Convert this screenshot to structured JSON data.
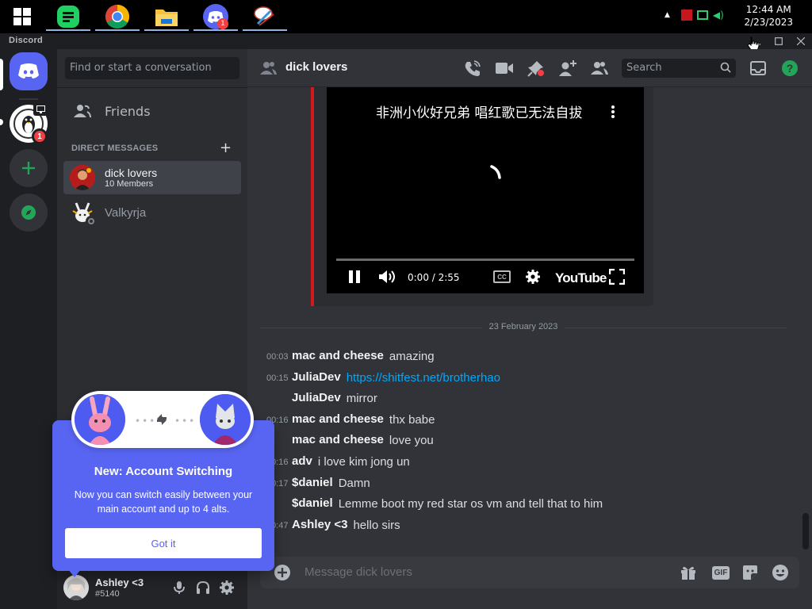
{
  "taskbar": {
    "apps": [
      {
        "name": "start",
        "icon": "windows-logo-icon"
      },
      {
        "name": "notes",
        "icon": "green-notes-icon"
      },
      {
        "name": "chrome",
        "icon": "chrome-icon"
      },
      {
        "name": "explorer",
        "icon": "folder-icon"
      },
      {
        "name": "discord",
        "icon": "discord-icon",
        "badge": "1"
      },
      {
        "name": "paint",
        "icon": "paint-brush-icon"
      }
    ],
    "clock_time": "12:44 AM",
    "clock_date": "2/23/2023"
  },
  "window": {
    "app_label": "Discord"
  },
  "servers": {
    "badge_count": "1"
  },
  "sidebar": {
    "search_placeholder": "Find or start a conversation",
    "friends_label": "Friends",
    "dm_heading": "DIRECT MESSAGES",
    "dms": [
      {
        "name": "dick lovers",
        "sub": "10 Members",
        "active": true
      },
      {
        "name": "Valkyrja",
        "sub": "",
        "active": false
      }
    ]
  },
  "user": {
    "name": "Ashley <3",
    "tag": "#5140"
  },
  "header": {
    "channel_name": "dick lovers",
    "search_placeholder": "Search"
  },
  "embed": {
    "video_title": "非洲小伙好兄弟 唱红歌已无法自拔",
    "time": "0:00 / 2:55",
    "provider": "YouTube",
    "cc_label": "CC"
  },
  "chat": {
    "date_divider": "23 February 2023",
    "messages": [
      {
        "time": "00:03",
        "author": "mac and cheese",
        "content": "amazing",
        "link": false
      },
      {
        "time": "00:15",
        "author": "JuliaDev",
        "content": "https://shitfest.net/brotherhao",
        "link": true
      },
      {
        "time": "",
        "author": "JuliaDev",
        "content": "mirror",
        "link": false
      },
      {
        "time": "00:16",
        "author": "mac and cheese",
        "content": "thx babe",
        "link": false
      },
      {
        "time": "",
        "author": "mac and cheese",
        "content": "love you",
        "link": false
      },
      {
        "time": "00:16",
        "author": "adv",
        "content": "i love kim jong un",
        "link": false
      },
      {
        "time": "00:17",
        "author": "$daniel",
        "content": "Damn",
        "link": false
      },
      {
        "time": "",
        "author": "$daniel",
        "content": "Lemme boot my red star os vm and tell that to him",
        "link": false
      },
      {
        "time": "00:47",
        "author": "Ashley <3",
        "content": "hello sirs",
        "link": false
      }
    ],
    "composer_placeholder": "Message dick lovers",
    "gif_label": "GIF"
  },
  "popup": {
    "title": "New: Account Switching",
    "text": "Now you can switch easily between your main account and up to 4 alts.",
    "button": "Got it"
  },
  "colors": {
    "blurple": "#5865f2",
    "green": "#23a559",
    "red": "#f23f43",
    "link": "#00a8fc"
  }
}
